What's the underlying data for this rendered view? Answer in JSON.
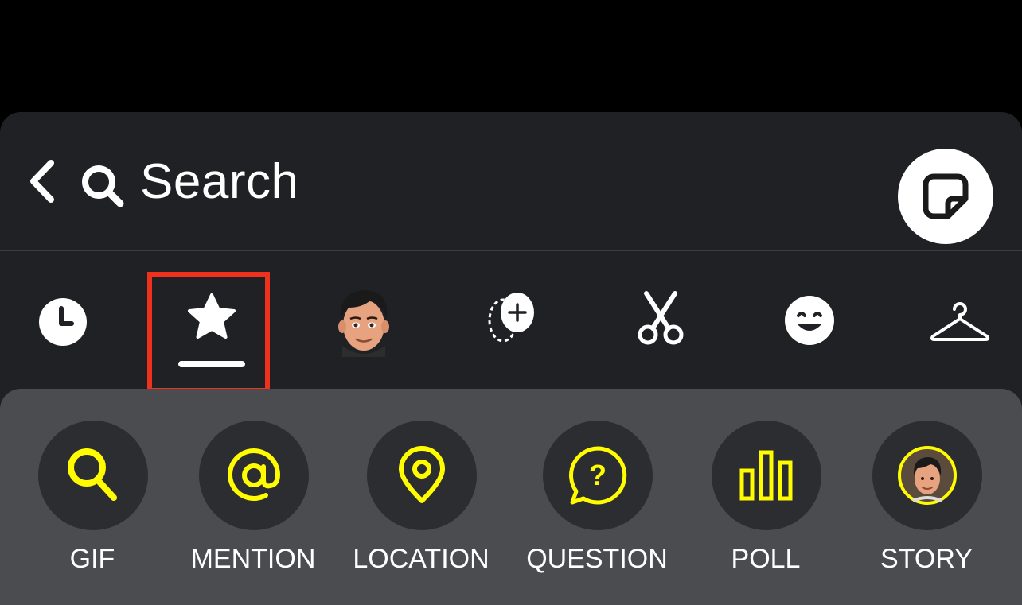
{
  "header": {
    "search_label": "Search"
  },
  "tabs": [
    {
      "id": "recents",
      "icon": "clock-icon"
    },
    {
      "id": "favorites",
      "icon": "star-icon",
      "selected": true
    },
    {
      "id": "bitmoji",
      "icon": "bitmoji-avatar-icon"
    },
    {
      "id": "create",
      "icon": "add-face-icon"
    },
    {
      "id": "cutouts",
      "icon": "scissors-icon"
    },
    {
      "id": "emoji",
      "icon": "smiley-face-icon"
    },
    {
      "id": "clothing",
      "icon": "hanger-icon"
    }
  ],
  "shortcuts": [
    {
      "label": "GIF",
      "icon": "search-icon"
    },
    {
      "label": "MENTION",
      "icon": "at-sign-icon"
    },
    {
      "label": "LOCATION",
      "icon": "location-pin-icon"
    },
    {
      "label": "QUESTION",
      "icon": "question-bubble-icon"
    },
    {
      "label": "POLL",
      "icon": "poll-bars-icon"
    },
    {
      "label": "STORY",
      "icon": "bitmoji-avatar-icon"
    }
  ],
  "colors": {
    "accent_yellow": "#fffc00",
    "highlight_red": "#f0311e",
    "panel_bg": "#202124",
    "tray_bg": "#4a4c50"
  }
}
